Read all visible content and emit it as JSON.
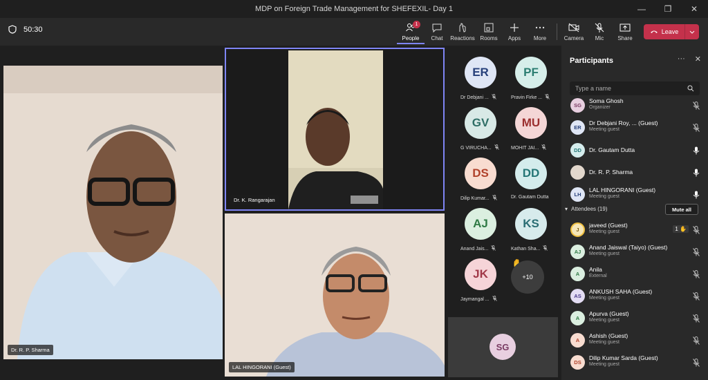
{
  "window": {
    "title": "MDP on Foreign Trade Management for SHEFEXIL- Day 1"
  },
  "toolbar": {
    "timer": "50:30",
    "people_label": "People",
    "people_badge": "1",
    "chat_label": "Chat",
    "reactions_label": "Reactions",
    "rooms_label": "Rooms",
    "apps_label": "Apps",
    "more_label": "More",
    "camera_label": "Camera",
    "mic_label": "Mic",
    "share_label": "Share",
    "leave_label": "Leave"
  },
  "videos": {
    "sharma": "Dr. R. P. Sharma",
    "rangarajan": "Dr. K. Rangarajan",
    "lal": "LAL HINGORANI (Guest)"
  },
  "grid": [
    {
      "initials": "ER",
      "name": "Dr Debjani ...",
      "bg": "#dfe6f5",
      "fg": "#27407a"
    },
    {
      "initials": "PF",
      "name": "Pravin Firke ...",
      "bg": "#d6eeea",
      "fg": "#2b7d71"
    },
    {
      "initials": "GV",
      "name": "G VIRUCHA...",
      "bg": "#d8e9e6",
      "fg": "#2f6e66"
    },
    {
      "initials": "MU",
      "name": "MOHIT JAI...",
      "bg": "#f4d6d6",
      "fg": "#9b2f2f"
    },
    {
      "initials": "DS",
      "name": "Dilip Kumar...",
      "bg": "#f8dcd0",
      "fg": "#b0412a"
    },
    {
      "initials": "DD",
      "name": "Dr. Gautam Dutta",
      "bg": "#d4ecec",
      "fg": "#247575"
    },
    {
      "initials": "AJ",
      "name": "Anand Jais...",
      "bg": "#dbefe0",
      "fg": "#2f7a45"
    },
    {
      "initials": "KS",
      "name": "Kathan Sha...",
      "bg": "#d7ebec",
      "fg": "#2a6d73"
    },
    {
      "initials": "JK",
      "name": "Jaymangal ...",
      "bg": "#f6d4d8",
      "fg": "#a13848"
    }
  ],
  "grid_more": "+10",
  "self": {
    "initials": "SG"
  },
  "panel": {
    "title": "Participants",
    "search_placeholder": "Type a name",
    "attendees_label": "Attendees (19)",
    "mute_all": "Mute all",
    "presenters": [
      {
        "initials": "SG",
        "name": "Soma Ghosh",
        "role": "Organizer",
        "bg": "#e8cfe0",
        "fg": "#7a3b63",
        "mic": "off"
      },
      {
        "initials": "ER",
        "name": "Dr Debjani Roy, ...  (Guest)",
        "role": "Meeting guest",
        "bg": "#dfe6f5",
        "fg": "#27407a",
        "mic": "off"
      },
      {
        "initials": "DD",
        "name": "Dr. Gautam Dutta",
        "role": "",
        "bg": "#d4ecec",
        "fg": "#247575",
        "mic": "on"
      },
      {
        "initials": "",
        "name": "Dr. R. P. Sharma",
        "role": "",
        "bg": "#e2d7cc",
        "fg": "#444",
        "mic": "on"
      },
      {
        "initials": "LH",
        "name": "LAL HINGORANI (Guest)",
        "role": "Meeting guest",
        "bg": "#dfe6f5",
        "fg": "#27407a",
        "mic": "on"
      }
    ],
    "attendees": [
      {
        "initials": "J",
        "name": "javeed (Guest)",
        "role": "Meeting guest",
        "bg": "#f5e6b8",
        "fg": "#7a5b10",
        "mic": "off",
        "hand": "1 ✋"
      },
      {
        "initials": "AJ",
        "name": "Anand Jaiswal (Taiyo) (Guest)",
        "role": "Meeting guest",
        "bg": "#dbefe0",
        "fg": "#2f7a45",
        "mic": "off"
      },
      {
        "initials": "A",
        "name": "Anila",
        "role": "External",
        "bg": "#dbefe0",
        "fg": "#2f7a45",
        "mic": "off"
      },
      {
        "initials": "AS",
        "name": "ANKUSH SAHA (Guest)",
        "role": "Meeting guest",
        "bg": "#e3dcf3",
        "fg": "#4b3a8a",
        "mic": "off"
      },
      {
        "initials": "A",
        "name": "Apurva (Guest)",
        "role": "Meeting guest",
        "bg": "#dbefe0",
        "fg": "#2f7a45",
        "mic": "off"
      },
      {
        "initials": "A",
        "name": "Ashish (Guest)",
        "role": "Meeting guest",
        "bg": "#f8dcd0",
        "fg": "#b0412a",
        "mic": "off"
      },
      {
        "initials": "DS",
        "name": "Dilip Kumar Sarda (Guest)",
        "role": "Meeting guest",
        "bg": "#f8dcd0",
        "fg": "#b0412a",
        "mic": "off"
      }
    ]
  }
}
